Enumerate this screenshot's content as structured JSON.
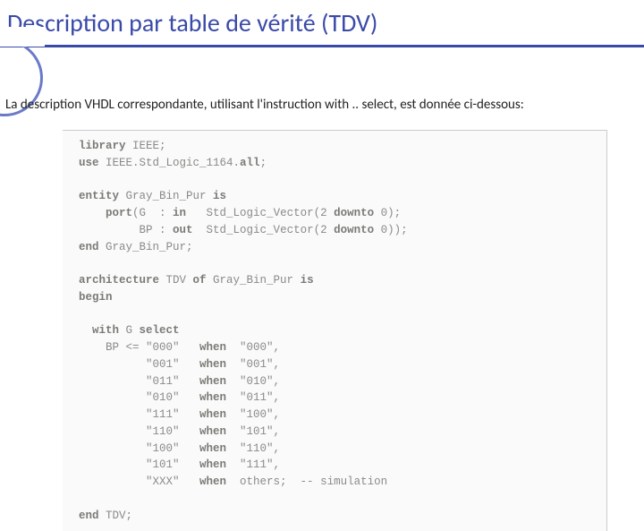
{
  "title": "Description par table de vérité (TDV)",
  "subtitle": "La description VHDL correspondante, utilisant l'instruction with .. select, est donnée ci-dessous:",
  "code": {
    "l01a": "library",
    "l01b": " IEEE;",
    "l02a": "use",
    "l02b": " IEEE.Std_Logic_1164.",
    "l02c": "all",
    "l02d": ";",
    "l03": "",
    "l04a": "entity",
    "l04b": " Gray_Bin_Pur ",
    "l04c": "is",
    "l05a": "    port",
    "l05b": "(G  : ",
    "l05c": "in",
    "l05d": "   Std_Logic_Vector(2 ",
    "l05e": "downto",
    "l05f": " 0);",
    "l06a": "         BP : ",
    "l06b": "out",
    "l06c": "  Std_Logic_Vector(2 ",
    "l06d": "downto",
    "l06e": " 0));",
    "l07a": "end",
    "l07b": " Gray_Bin_Pur;",
    "l08": "",
    "l09a": "architecture",
    "l09b": " TDV ",
    "l09c": "of",
    "l09d": " Gray_Bin_Pur ",
    "l09e": "is",
    "l10a": "begin",
    "l11": "",
    "l12a": "  with",
    "l12b": " G ",
    "l12c": "select",
    "l13a": "    BP <= \"000\"   ",
    "l13b": "when",
    "l13c": "  \"000\",",
    "l14a": "          \"001\"   ",
    "l14b": "when",
    "l14c": "  \"001\",",
    "l15a": "          \"011\"   ",
    "l15b": "when",
    "l15c": "  \"010\",",
    "l16a": "          \"010\"   ",
    "l16b": "when",
    "l16c": "  \"011\",",
    "l17a": "          \"111\"   ",
    "l17b": "when",
    "l17c": "  \"100\",",
    "l18a": "          \"110\"   ",
    "l18b": "when",
    "l18c": "  \"101\",",
    "l19a": "          \"100\"   ",
    "l19b": "when",
    "l19c": "  \"110\",",
    "l20a": "          \"101\"   ",
    "l20b": "when",
    "l20c": "  \"111\",",
    "l21a": "          \"XXX\"   ",
    "l21b": "when",
    "l21c": "  others;  -- simulation",
    "l22": "",
    "l23a": "end",
    "l23b": " TDV;"
  }
}
